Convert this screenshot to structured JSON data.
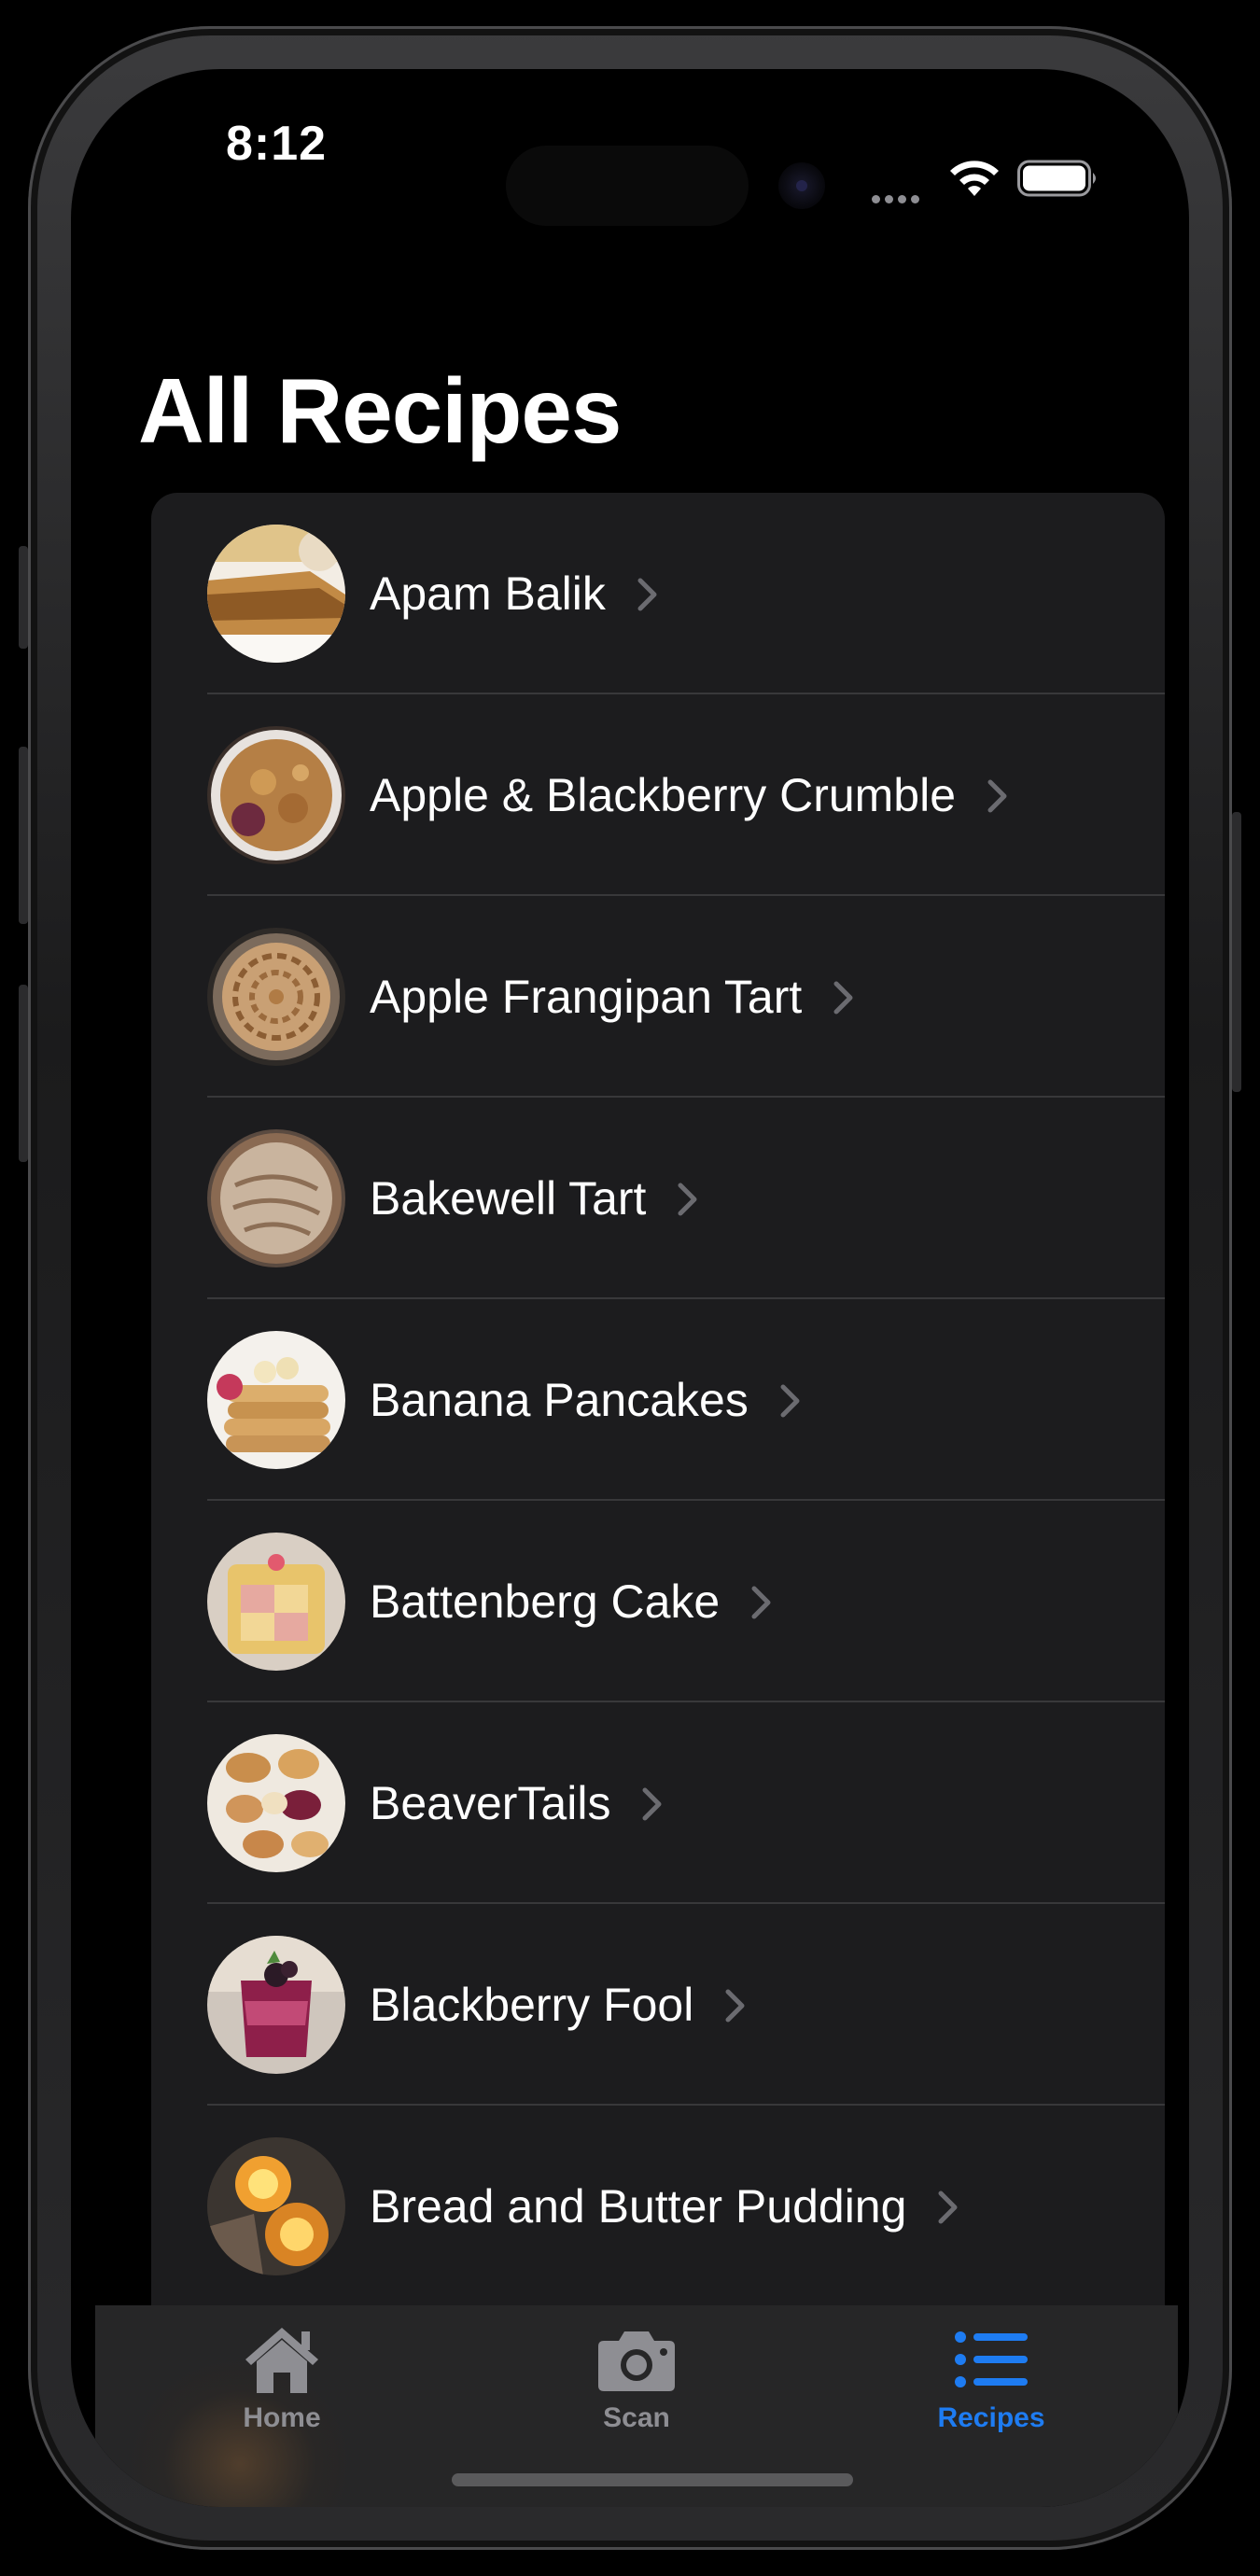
{
  "status_bar": {
    "time": "8:12"
  },
  "page": {
    "title": "All Recipes"
  },
  "recipes": [
    {
      "name": "Apam Balik"
    },
    {
      "name": "Apple & Blackberry Crumble"
    },
    {
      "name": "Apple Frangipan Tart"
    },
    {
      "name": "Bakewell Tart"
    },
    {
      "name": "Banana Pancakes"
    },
    {
      "name": "Battenberg Cake"
    },
    {
      "name": "BeaverTails"
    },
    {
      "name": "Blackberry Fool"
    },
    {
      "name": "Bread and Butter Pudding"
    }
  ],
  "tab_bar": {
    "tabs": [
      {
        "label": "Home",
        "icon": "house-icon",
        "selected": false
      },
      {
        "label": "Scan",
        "icon": "camera-icon",
        "selected": false
      },
      {
        "label": "Recipes",
        "icon": "list-icon",
        "selected": true
      }
    ]
  },
  "colors": {
    "accent": "#1e7cf2",
    "tab_inactive": "#8e8e93",
    "row_background": "#1c1c1e",
    "separator": "#38383a"
  }
}
